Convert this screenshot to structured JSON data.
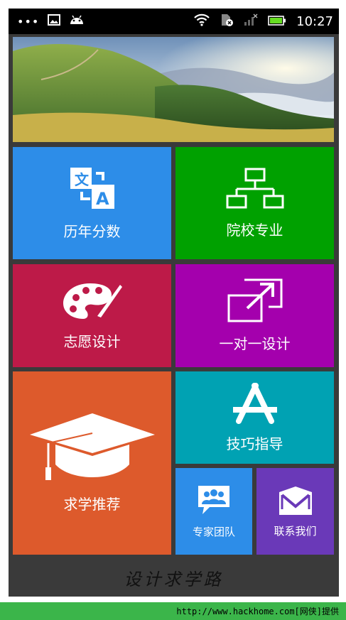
{
  "status_bar": {
    "dots": "•••",
    "time": "10:27",
    "colors": {
      "background": "#000000",
      "battery": "#66dd22"
    }
  },
  "banner": {
    "icon": "mountain-landscape-image"
  },
  "tiles": {
    "lnfs": {
      "label": "历年分数",
      "icon": "translate-icon",
      "color": "#2d8de8"
    },
    "yxzy": {
      "label": "院校专业",
      "icon": "hierarchy-icon",
      "color": "#00a100"
    },
    "zysj": {
      "label": "志愿设计",
      "icon": "palette-icon",
      "color": "#bd1a48"
    },
    "ydysj": {
      "label": "一对一设计",
      "icon": "external-link-icon",
      "color": "#a400ad"
    },
    "qxtj": {
      "label": "求学推荐",
      "icon": "graduation-cap-icon",
      "color": "#dd5a2c"
    },
    "jqzd": {
      "label": "技巧指导",
      "icon": "app-store-icon",
      "color": "#00a2b3"
    },
    "zjtd": {
      "label": "专家团队",
      "icon": "team-chat-icon",
      "color": "#2d8de8"
    },
    "lxwm": {
      "label": "联系我们",
      "icon": "mail-icon",
      "color": "#6a39b8"
    }
  },
  "footer": {
    "title": "设计求学路"
  },
  "watermark": {
    "text": "http://www.hackhome.com[网侠]提供"
  }
}
